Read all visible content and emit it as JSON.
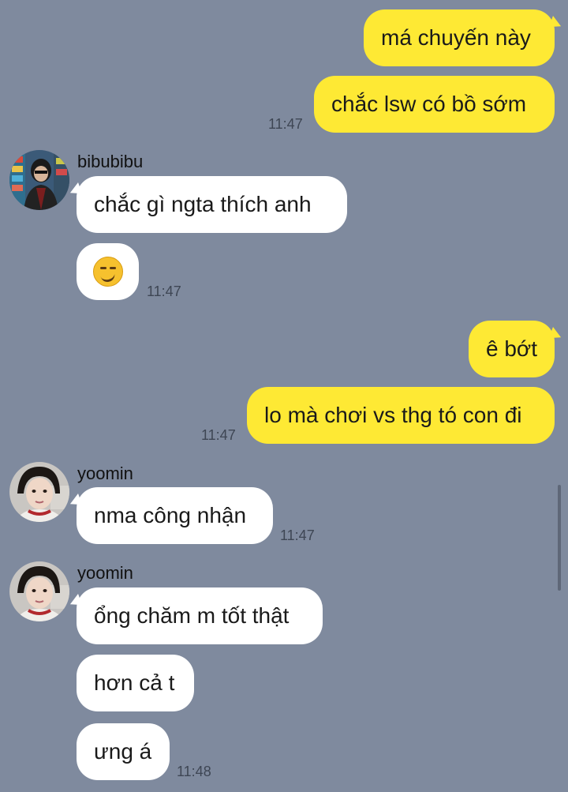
{
  "colors": {
    "background": "#7F8A9E",
    "outgoing_bubble": "#FEE934",
    "incoming_bubble": "#FFFFFF"
  },
  "messages": {
    "m1": {
      "text": "má chuyến này"
    },
    "m2": {
      "text": "chắc lsw có bồ sớm",
      "time": "11:47"
    },
    "m3": {
      "sender": "bibubibu",
      "text": "chắc gì ngta thích anh"
    },
    "m4": {
      "text": "",
      "emoji": "smirk-emoji",
      "time": "11:47"
    },
    "m5": {
      "text": "ê bớt"
    },
    "m6": {
      "text": "lo mà chơi vs thg tó con đi",
      "time": "11:47"
    },
    "m7": {
      "sender": "yoomin",
      "text": "nma công nhận",
      "time": "11:47"
    },
    "m8": {
      "sender": "yoomin",
      "text": "ổng chăm m tốt thật"
    },
    "m9": {
      "text": "hơn cả t"
    },
    "m10": {
      "text": "ưng á",
      "time": "11:48"
    }
  }
}
